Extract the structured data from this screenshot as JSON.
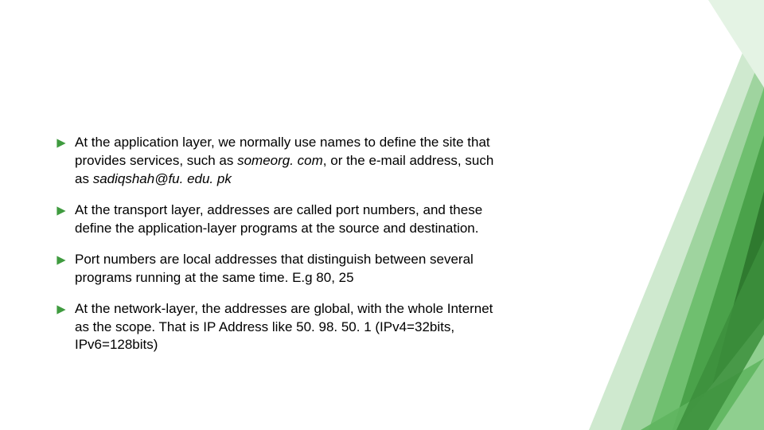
{
  "bullets": {
    "b1": {
      "t1": "At the application layer, we normally use names to define the site that provides services, such as ",
      "i1": "someorg. com",
      "t2": ", or the e-mail address, such as ",
      "i2": "sadiqshah@fu. edu. pk"
    },
    "b2": {
      "t1": "At the transport layer, addresses are called port numbers, and these define the application-layer programs at the source and destination."
    },
    "b3": {
      "t1": "Port numbers are local addresses that distinguish between several programs running at the same time. E.g 80, 25"
    },
    "b4": {
      "t1": "At the network-layer, the addresses are global, with the whole Internet as the scope. That is IP Address like 50. 98. 50. 1 (IPv4=32bits, IPv6=128bits)"
    }
  },
  "colors": {
    "bullet": "#3f9b3f",
    "deco_dark": "#2f7a2f",
    "deco_mid": "#4aa24a",
    "deco_light": "#7fc77f",
    "deco_pale": "#b8e0b8"
  }
}
